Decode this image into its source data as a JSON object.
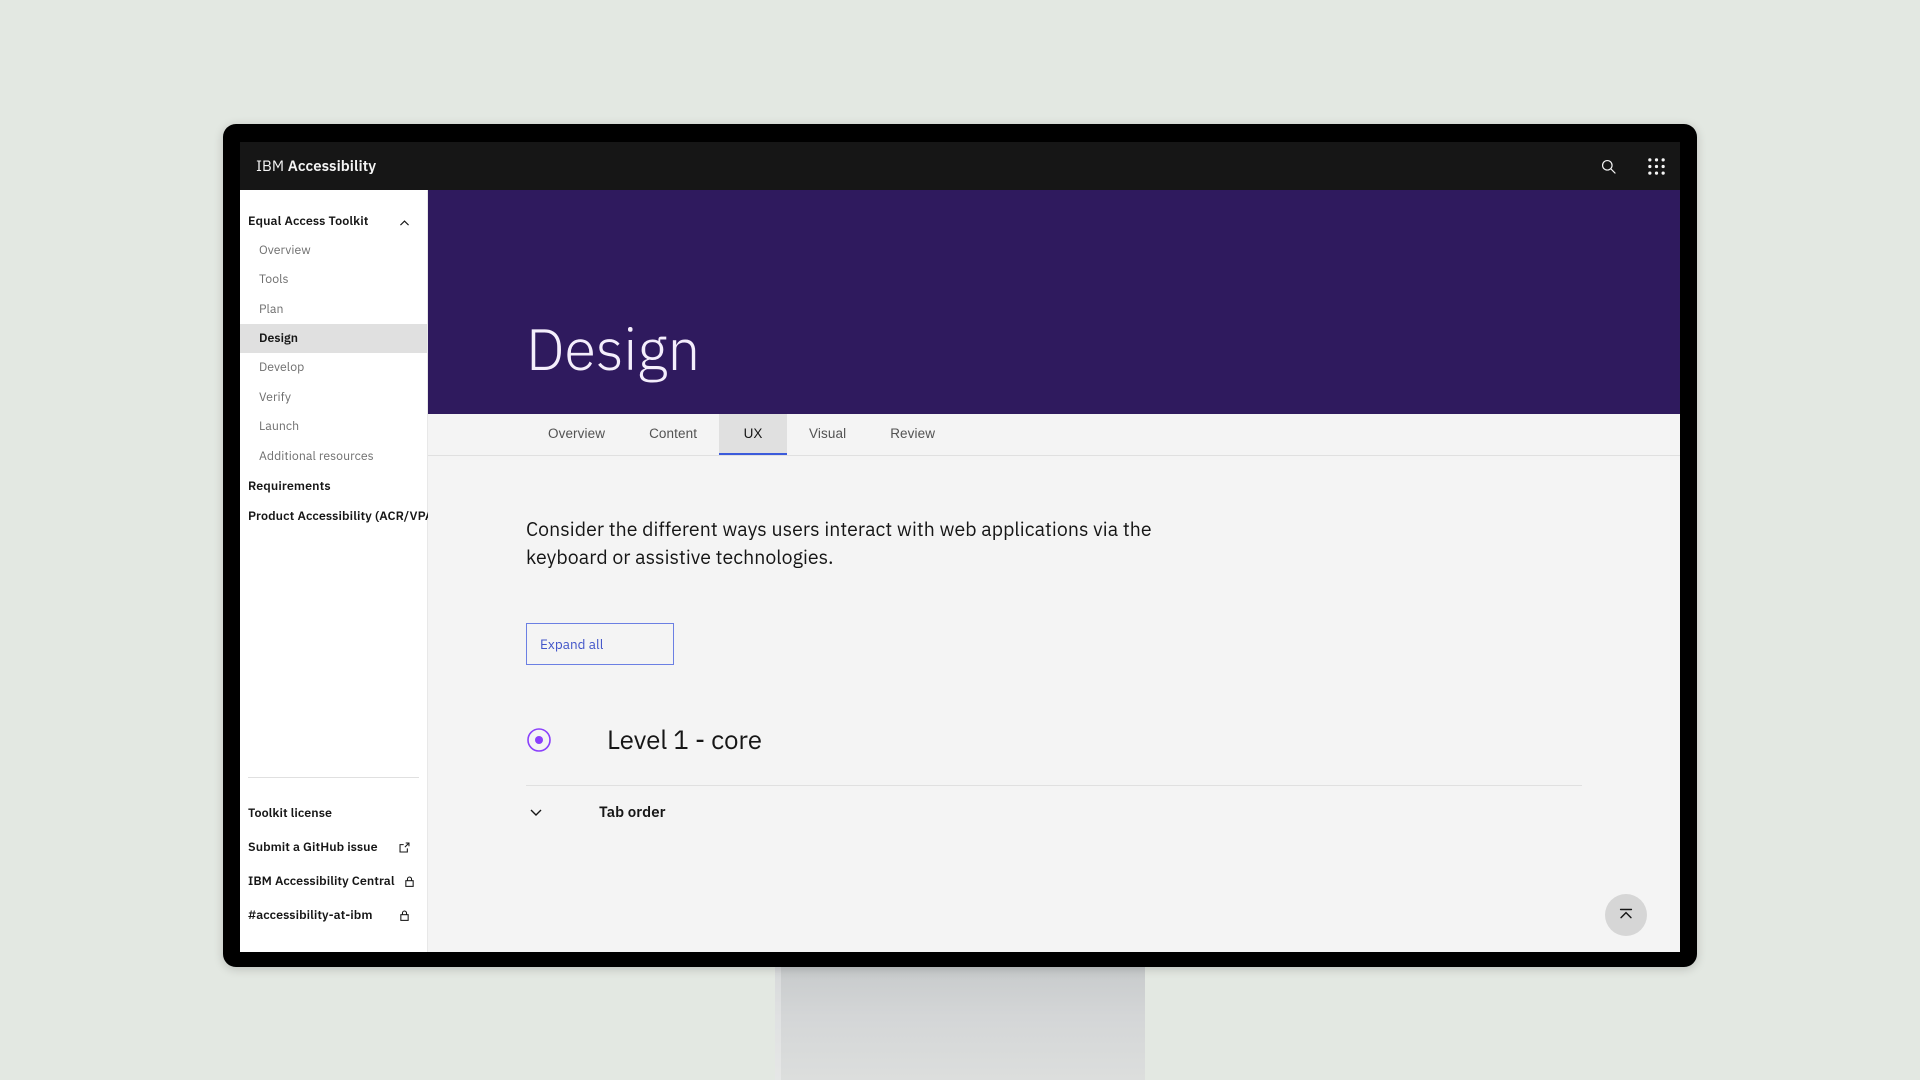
{
  "header": {
    "brand_prefix": "IBM",
    "brand_name": "Accessibility",
    "search_icon": "search-icon",
    "app_switcher_icon": "grid-nine-dots-icon"
  },
  "sidebar": {
    "section": {
      "label": "Equal Access Toolkit",
      "collapse_icon": "chevron-up-icon",
      "items": [
        {
          "label": "Overview",
          "selected": false
        },
        {
          "label": "Tools",
          "selected": false
        },
        {
          "label": "Plan",
          "selected": false
        },
        {
          "label": "Design",
          "selected": true
        },
        {
          "label": "Develop",
          "selected": false
        },
        {
          "label": "Verify",
          "selected": false
        },
        {
          "label": "Launch",
          "selected": false
        },
        {
          "label": "Additional resources",
          "selected": false
        }
      ]
    },
    "top_links": [
      {
        "label": "Requirements"
      },
      {
        "label": "Product Accessibility (ACR/VPAT)"
      }
    ],
    "footer_links": [
      {
        "label": "Toolkit license",
        "icon": "none"
      },
      {
        "label": "Submit a GitHub issue",
        "icon": "external-link-icon"
      },
      {
        "label": "IBM Accessibility Central",
        "icon": "lock-icon"
      },
      {
        "label": "#accessibility-at-ibm",
        "icon": "lock-icon"
      }
    ]
  },
  "hero": {
    "title": "Design",
    "background_color": "#2f1a5e"
  },
  "tabs": [
    {
      "label": "Overview",
      "active": false
    },
    {
      "label": "Content",
      "active": false
    },
    {
      "label": "UX",
      "active": true
    },
    {
      "label": "Visual",
      "active": false
    },
    {
      "label": "Review",
      "active": false
    }
  ],
  "main": {
    "lead": "Consider the different ways users interact with web applications via the keyboard or assistive technologies.",
    "expand_all_label": "Expand all",
    "level": {
      "icon": "radio-dot-icon",
      "icon_color": "#8a3ffc",
      "title": "Level 1 - core"
    },
    "accordion": [
      {
        "label": "Tab order",
        "expand_icon": "chevron-down-icon"
      }
    ],
    "back_to_top_icon": "scroll-to-top-icon"
  },
  "colors": {
    "page_background": "#e3e8e2",
    "bezel": "#000000",
    "header_bar": "#161616",
    "hero_purple": "#2f1a5e",
    "tab_accent": "#3b5bdb",
    "button_border": "#6b7fe3",
    "button_text": "#4255c9"
  }
}
